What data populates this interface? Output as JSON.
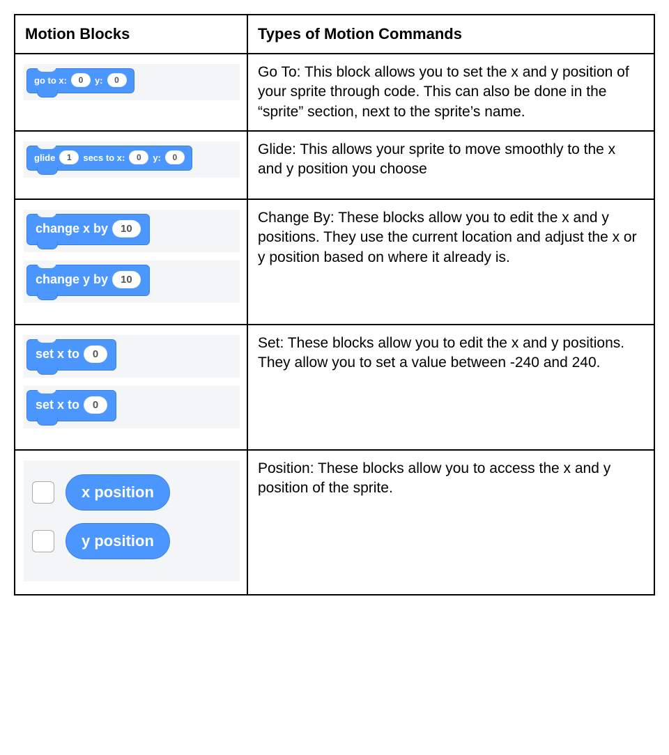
{
  "headers": {
    "left": "Motion Blocks",
    "right": "Types of Motion Commands"
  },
  "rows": [
    {
      "block": {
        "kind": "stack-small",
        "parts": [
          "go to x:",
          "0",
          "y:",
          "0"
        ]
      },
      "desc": "Go To: This block allows you to set the x and y position of your sprite through code. This can also be done in the “sprite” section, next to the sprite’s name."
    },
    {
      "block": {
        "kind": "stack-small",
        "parts": [
          "glide",
          "1",
          "secs to x:",
          "0",
          "y:",
          "0"
        ]
      },
      "desc": "Glide: This allows your sprite to move smoothly to the x and y position you choose"
    },
    {
      "block": {
        "kind": "two-stack",
        "first": [
          "change x by",
          "10"
        ],
        "second": [
          "change y by",
          "10"
        ]
      },
      "desc": "Change By: These blocks allow you to edit the x and y positions. They use the current location and adjust the x or y position based on where it already is."
    },
    {
      "block": {
        "kind": "two-stack",
        "first": [
          "set x to",
          "0"
        ],
        "second": [
          "set x to",
          "0"
        ]
      },
      "desc": "Set: These blocks allow you to edit the x and y positions. They allow you to set a value between -240 and 240."
    },
    {
      "block": {
        "kind": "reporters",
        "items": [
          "x position",
          "y position"
        ]
      },
      "desc": "Position: These blocks allow you to access the x and y position of the sprite."
    }
  ]
}
